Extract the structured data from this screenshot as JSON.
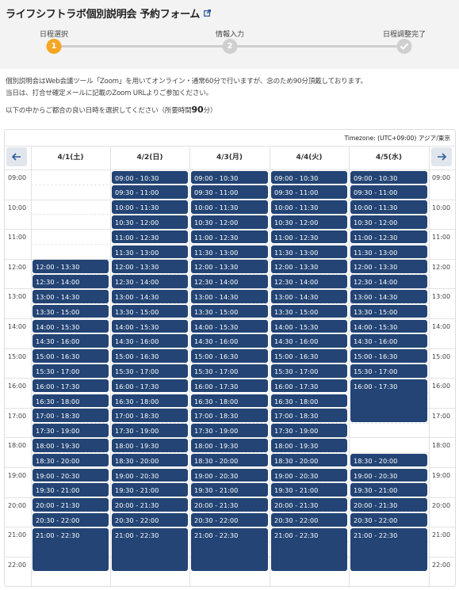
{
  "page": {
    "title": "ライフシフトラボ個別説明会 予約フォーム",
    "steps": [
      {
        "label": "日程選択",
        "number": "1",
        "state": "active"
      },
      {
        "label": "情報入力",
        "number": "2",
        "state": "pending"
      },
      {
        "label": "日程調整完了",
        "number": "",
        "state": "pending"
      }
    ],
    "description_line1": "個別説明会はWeb会議ツール「Zoom」を用いてオンライン・通常60分で行いますが、念のため90分頂戴しております。",
    "description_line2": "当日は、打合せ確定メールに記載のZoom URLよりご参加ください。",
    "instruction_prefix": "以下の中からご都合の良い日時を選択してください（所要時間",
    "instruction_minutes": "90",
    "instruction_suffix": "分）"
  },
  "colors": {
    "accent": "#f5a623",
    "slot": "#234474",
    "step_inactive": "#cfcfcf",
    "nav_arrow": "#2d5d9c"
  },
  "calendar": {
    "timezone": "Timezone: (UTC+09:00) アジア/東京",
    "prev_icon": "arrow-left-icon",
    "next_icon": "arrow-right-icon",
    "hours": [
      "09:00",
      "10:00",
      "11:00",
      "12:00",
      "13:00",
      "14:00",
      "15:00",
      "16:00",
      "17:00",
      "18:00",
      "19:00",
      "20:00",
      "21:00",
      "22:00"
    ],
    "days": [
      {
        "label": "4/1(土)",
        "slots": [
          "12:00 - 13:30",
          "12:30 - 14:00",
          "13:00 - 14:30",
          "13:30 - 15:00",
          "14:00 - 15:30",
          "14:30 - 16:00",
          "15:00 - 16:30",
          "15:30 - 17:00",
          "16:00 - 17:30",
          "16:30 - 18:00",
          "17:00 - 18:30",
          "17:30 - 19:00",
          "18:00 - 19:30",
          "18:30 - 20:00",
          "19:00 - 20:30",
          "19:30 - 21:00",
          "20:00 - 21:30",
          "20:30 - 22:00",
          "21:00 - 22:30"
        ]
      },
      {
        "label": "4/2(日)",
        "slots": [
          "09:00 - 10:30",
          "09:30 - 11:00",
          "10:00 - 11:30",
          "10:30 - 12:00",
          "11:00 - 12:30",
          "11:30 - 13:00",
          "12:00 - 13:30",
          "12:30 - 14:00",
          "13:00 - 14:30",
          "13:30 - 15:00",
          "14:00 - 15:30",
          "14:30 - 16:00",
          "15:00 - 16:30",
          "15:30 - 17:00",
          "16:00 - 17:30",
          "16:30 - 18:00",
          "17:00 - 18:30",
          "17:30 - 19:00",
          "18:00 - 19:30",
          "18:30 - 20:00",
          "19:00 - 20:30",
          "19:30 - 21:00",
          "20:00 - 21:30",
          "20:30 - 22:00",
          "21:00 - 22:30"
        ]
      },
      {
        "label": "4/3(月)",
        "slots": [
          "09:00 - 10:30",
          "09:30 - 11:00",
          "10:00 - 11:30",
          "10:30 - 12:00",
          "11:00 - 12:30",
          "11:30 - 13:00",
          "12:00 - 13:30",
          "12:30 - 14:00",
          "13:00 - 14:30",
          "13:30 - 15:00",
          "14:00 - 15:30",
          "14:30 - 16:00",
          "15:00 - 16:30",
          "15:30 - 17:00",
          "16:00 - 17:30",
          "16:30 - 18:00",
          "17:00 - 18:30",
          "17:30 - 19:00",
          "18:00 - 19:30",
          "18:30 - 20:00",
          "19:00 - 20:30",
          "19:30 - 21:00",
          "20:00 - 21:30",
          "20:30 - 22:00",
          "21:00 - 22:30"
        ]
      },
      {
        "label": "4/4(火)",
        "slots": [
          "09:00 - 10:30",
          "09:30 - 11:00",
          "10:00 - 11:30",
          "10:30 - 12:00",
          "11:00 - 12:30",
          "11:30 - 13:00",
          "12:00 - 13:30",
          "12:30 - 14:00",
          "13:00 - 14:30",
          "13:30 - 15:00",
          "14:00 - 15:30",
          "14:30 - 16:00",
          "15:00 - 16:30",
          "15:30 - 17:00",
          "16:00 - 17:30",
          "16:30 - 18:00",
          "17:00 - 18:30",
          "17:30 - 19:00",
          "18:00 - 19:30",
          "18:30 - 20:00",
          "19:00 - 20:30",
          "19:30 - 21:00",
          "20:00 - 21:30",
          "20:30 - 22:00",
          "21:00 - 22:30"
        ]
      },
      {
        "label": "4/5(水)",
        "slots": [
          "09:00 - 10:30",
          "09:30 - 11:00",
          "10:00 - 11:30",
          "10:30 - 12:00",
          "11:00 - 12:30",
          "11:30 - 13:00",
          "12:00 - 13:30",
          "12:30 - 14:00",
          "13:00 - 14:30",
          "13:30 - 15:00",
          "14:00 - 15:30",
          "14:30 - 16:00",
          "15:00 - 16:30",
          "15:30 - 17:00",
          "16:00 - 17:30",
          "18:30 - 20:00",
          "19:00 - 20:30",
          "19:30 - 21:00",
          "20:00 - 21:30",
          "20:30 - 22:00",
          "21:00 - 22:30"
        ]
      }
    ]
  }
}
